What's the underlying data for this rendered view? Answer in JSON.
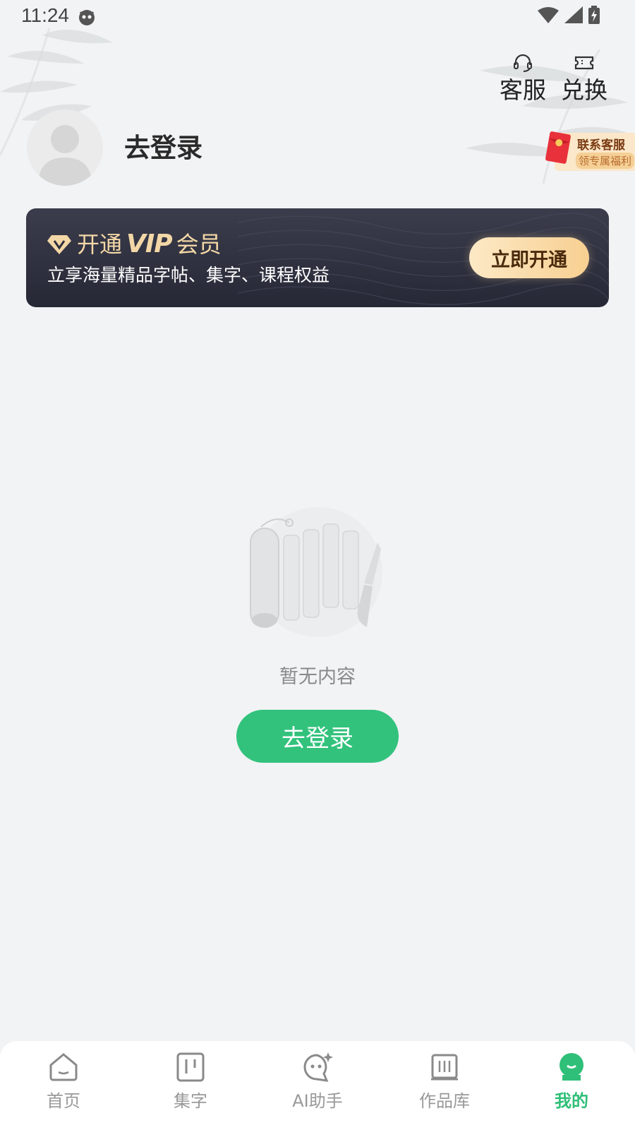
{
  "status_bar": {
    "time": "11:24"
  },
  "top_actions": [
    {
      "label": "客服",
      "icon": "headset-icon"
    },
    {
      "label": "兑换",
      "icon": "ticket-icon"
    }
  ],
  "profile": {
    "login_title": "去登录",
    "badge_line1": "联系客服",
    "badge_line2": "领专属福利"
  },
  "vip": {
    "title_prefix": "开通",
    "vip_word": "VIP",
    "title_suffix": "会员",
    "subtitle": "立享海量精品字帖、集字、课程权益",
    "button_label": "立即开通"
  },
  "empty_state": {
    "text": "暂无内容",
    "button_label": "去登录"
  },
  "bottom_nav": {
    "items": [
      {
        "label": "首页",
        "icon": "home-icon",
        "active": false
      },
      {
        "label": "集字",
        "icon": "collect-characters-icon",
        "active": false
      },
      {
        "label": "AI助手",
        "icon": "ai-assistant-icon",
        "active": false
      },
      {
        "label": "作品库",
        "icon": "works-library-icon",
        "active": false
      },
      {
        "label": "我的",
        "icon": "profile-icon",
        "active": true
      }
    ]
  },
  "colors": {
    "accent_green": "#32c27c",
    "vip_gold": "#f3d7a6",
    "vip_bg": "#2d2f3d",
    "page_bg": "#f2f3f5"
  }
}
